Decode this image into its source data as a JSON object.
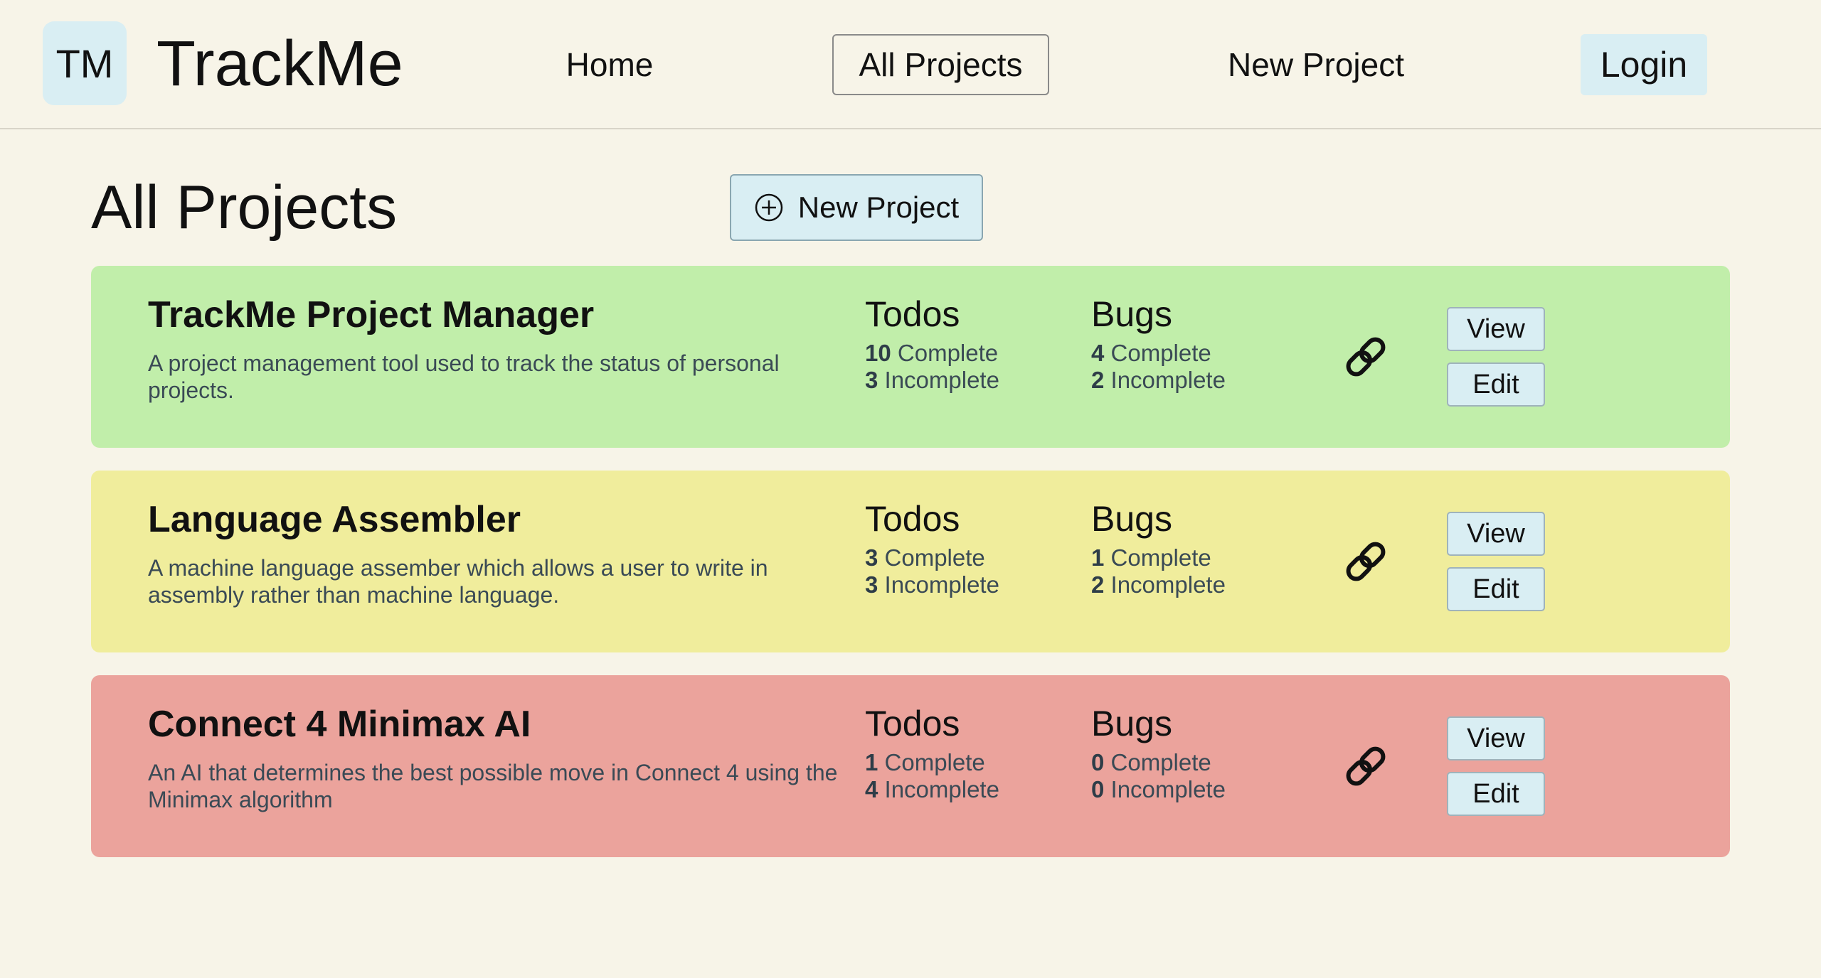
{
  "header": {
    "logo": "TM",
    "brand": "TrackMe",
    "nav": {
      "home": "Home",
      "all_projects": "All Projects",
      "new_project": "New Project",
      "login": "Login"
    }
  },
  "main": {
    "title": "All Projects",
    "new_project_button": "New Project",
    "new_project_icon": "plus-circle-icon",
    "link_icon": "link-icon",
    "projects": [
      {
        "name": "TrackMe Project Manager",
        "description": "A project management tool used to track the status of personal projects.",
        "color": "#c1eeaa",
        "todos_label": "Todos",
        "todos_complete": "10",
        "todos_incomplete": "3",
        "bugs_label": "Bugs",
        "bugs_complete": "4",
        "bugs_incomplete": "2",
        "complete_label": "Complete",
        "incomplete_label": "Incomplete",
        "view_label": "View",
        "edit_label": "Edit"
      },
      {
        "name": "Language Assembler",
        "description": "A machine language assember which allows a user to write in assembly rather than machine language.",
        "color": "#f0ed9c",
        "todos_label": "Todos",
        "todos_complete": "3",
        "todos_incomplete": "3",
        "bugs_label": "Bugs",
        "bugs_complete": "1",
        "bugs_incomplete": "2",
        "complete_label": "Complete",
        "incomplete_label": "Incomplete",
        "view_label": "View",
        "edit_label": "Edit"
      },
      {
        "name": "Connect 4 Minimax AI",
        "description": "An AI that determines the best possible move in Connect 4 using the Minimax algorithm",
        "color": "#eba39c",
        "todos_label": "Todos",
        "todos_complete": "1",
        "todos_incomplete": "4",
        "bugs_label": "Bugs",
        "bugs_complete": "0",
        "bugs_incomplete": "0",
        "complete_label": "Complete",
        "incomplete_label": "Incomplete",
        "view_label": "View",
        "edit_label": "Edit"
      }
    ]
  },
  "colors": {
    "background": "#f7f4e8",
    "button_bg": "#d9eef3",
    "text_muted": "#3a4a55"
  }
}
